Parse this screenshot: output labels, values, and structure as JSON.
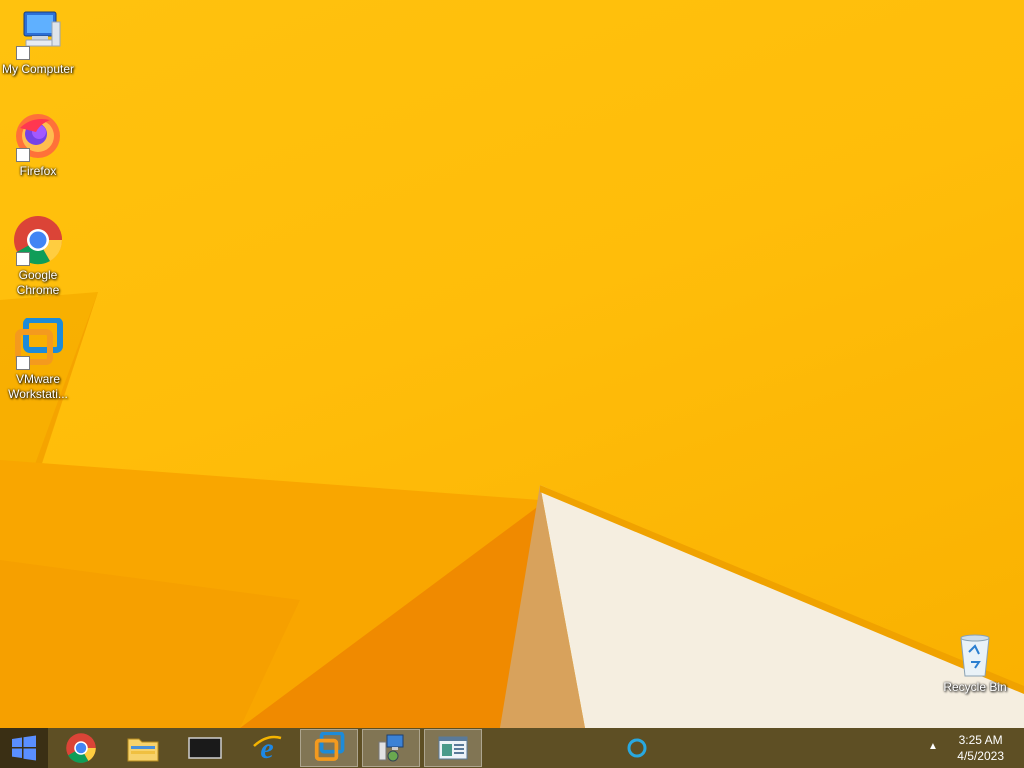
{
  "desktop": {
    "icons": [
      {
        "label": "My Computer",
        "icon": "computer-icon"
      },
      {
        "label": "Firefox",
        "icon": "firefox-icon"
      },
      {
        "label": "Google Chrome",
        "icon": "chrome-icon"
      },
      {
        "label": "VMware Workstati...",
        "icon": "vmware-icon"
      },
      {
        "label": "Recycle Bin",
        "icon": "recycle-bin-icon"
      }
    ],
    "colors": {
      "wallpaper": "#ffc20e",
      "taskbar": "#5e4f24"
    }
  },
  "taskbar": {
    "start_icon": "windows-logo-icon",
    "pinned": [
      {
        "name": "chrome",
        "icon": "chrome-icon"
      },
      {
        "name": "file-explorer",
        "icon": "folder-icon"
      },
      {
        "name": "terminal",
        "icon": "monitor-icon"
      },
      {
        "name": "internet-explorer",
        "icon": "ie-icon"
      },
      {
        "name": "vmware",
        "icon": "vmware-icon"
      },
      {
        "name": "network-settings",
        "icon": "network-computer-icon"
      },
      {
        "name": "control-panel",
        "icon": "window-icon"
      }
    ],
    "search_icon": "circle-search-icon",
    "tray_arrow": "▲",
    "time": "3:25 AM",
    "date": "4/5/2023"
  }
}
